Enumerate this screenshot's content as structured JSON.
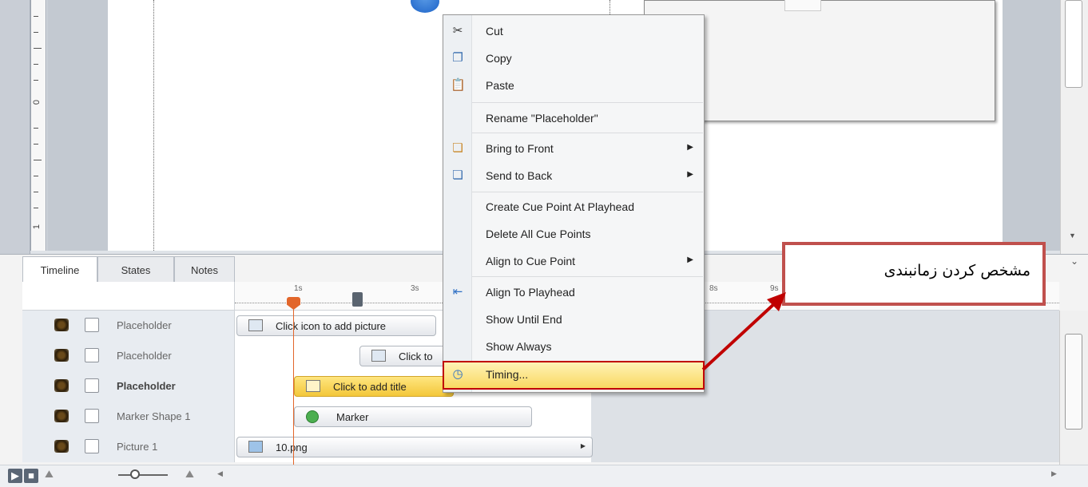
{
  "tabs": [
    "Timeline",
    "States",
    "Notes"
  ],
  "ruler_numbers": [
    "0",
    "1"
  ],
  "time_labels": [
    "1s",
    "3s",
    "8s",
    "9s"
  ],
  "rows": [
    {
      "name": "Placeholder",
      "bar_text": "Click icon to add picture"
    },
    {
      "name": "Placeholder",
      "bar_text": "Click to"
    },
    {
      "name": "Placeholder",
      "bar_text": "Click to add title"
    },
    {
      "name": "Marker Shape 1",
      "bar_text": "Marker"
    },
    {
      "name": "Picture 1",
      "bar_text": "10.png"
    }
  ],
  "menu": {
    "cut": "Cut",
    "copy": "Copy",
    "paste": "Paste",
    "rename": "Rename \"Placeholder\"",
    "bring_to_front": "Bring to Front",
    "send_to_back": "Send to Back",
    "create_cue": "Create Cue Point At Playhead",
    "delete_cues": "Delete All Cue Points",
    "align_cue": "Align to Cue Point",
    "align_playhead": "Align To Playhead",
    "show_until_end": "Show Until End",
    "show_always": "Show Always",
    "timing": "Timing..."
  },
  "callout_text": "مشخص کردن زمانبندی",
  "colors": {
    "highlight_border": "#c00000",
    "callout_border": "#c0504d",
    "playhead": "#e2662b",
    "menu_highlight": "#f9d862"
  },
  "icons": [
    "scissors-icon",
    "copy-icon",
    "paste-icon",
    "bring-front-icon",
    "send-back-icon",
    "align-playhead-icon",
    "clock-icon",
    "eye-icon",
    "picture-icon",
    "title-icon",
    "marker-icon",
    "play-icon",
    "stop-icon",
    "zoom-icon"
  ]
}
